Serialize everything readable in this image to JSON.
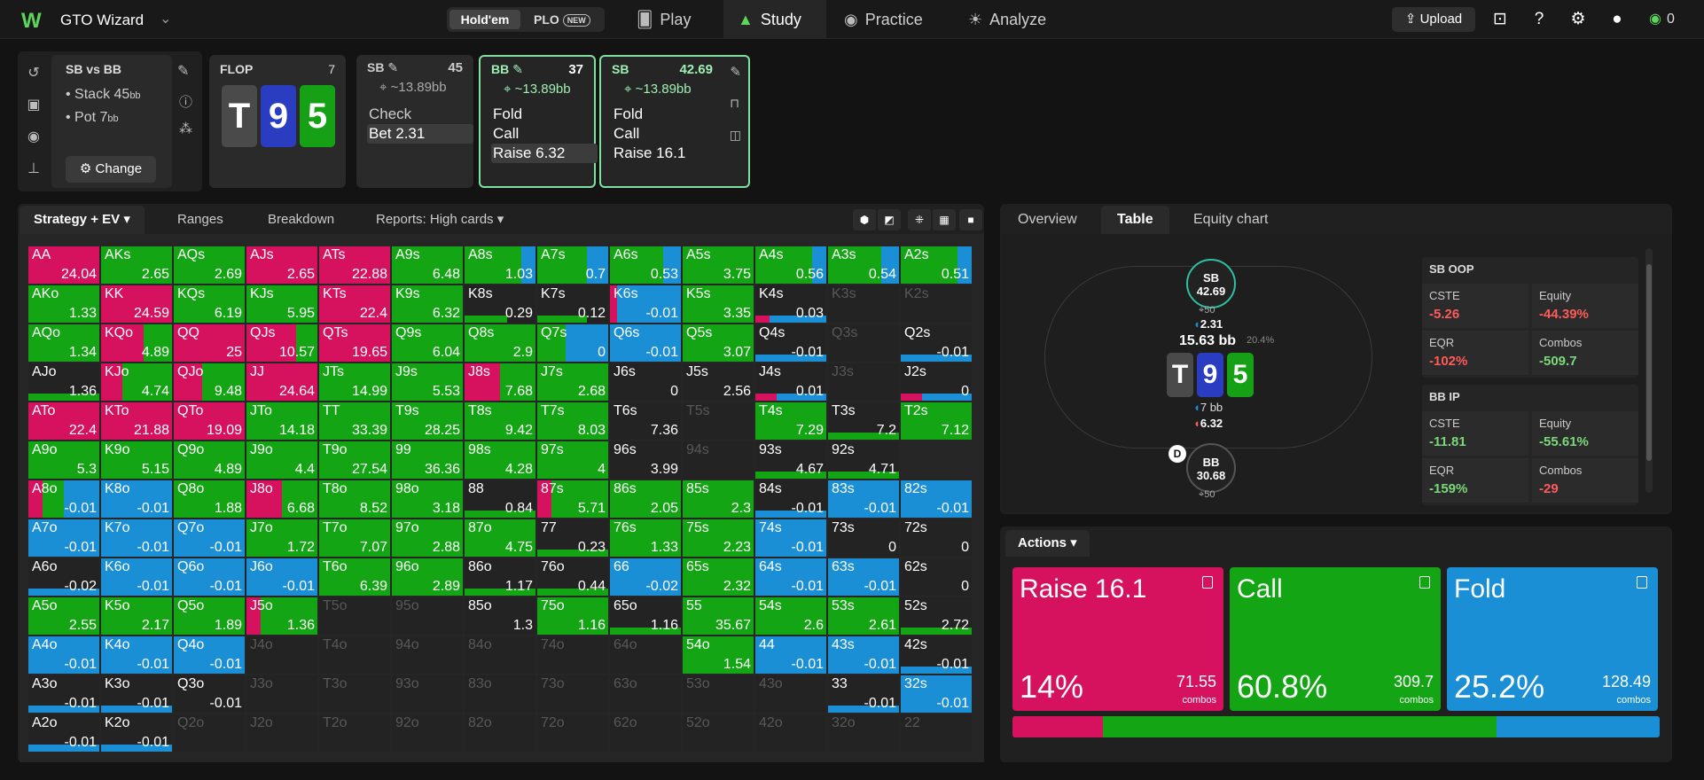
{
  "colors": {
    "raise": "#d6125e",
    "call": "#13a513",
    "fold": "#1a8fd6",
    "dark": "#232323",
    "accent": "#5ad65a"
  },
  "topbar": {
    "brand": "GTO Wizard",
    "modes": [
      "Hold'em",
      "PLO"
    ],
    "new_badge": "NEW",
    "nav": [
      "Play",
      "Study",
      "Practice",
      "Analyze"
    ],
    "upload": "Upload",
    "credits": "0",
    "icons": [
      "scan-icon",
      "help-icon",
      "settings-icon",
      "account-icon"
    ]
  },
  "spot": {
    "title": "SB vs BB",
    "stack_label": "Stack 45",
    "stack_unit": "bb",
    "pot_label": "Pot 7",
    "pot_unit": "bb",
    "change": "Change"
  },
  "flop": {
    "label": "FLOP",
    "pot": "7",
    "cards": [
      "T",
      "9",
      "5"
    ]
  },
  "decisions": [
    {
      "pos": "SB",
      "stack": "45",
      "eff": "~13.89bb",
      "actions": [
        "Check",
        "Bet 2.31"
      ],
      "hl": 1
    },
    {
      "pos": "BB",
      "stack": "37",
      "eff": "~13.89bb",
      "actions": [
        "Fold",
        "Call",
        "Raise 6.32"
      ],
      "hl": 2
    },
    {
      "pos": "SB",
      "stack": "42.69",
      "eff": "~13.89bb",
      "actions": [
        "Fold",
        "Call",
        "Raise 16.1"
      ],
      "hl": -1
    }
  ],
  "left_tabs": [
    "Strategy + EV",
    "Ranges",
    "Breakdown",
    "Reports: High cards"
  ],
  "right_tabs": [
    "Overview",
    "Table",
    "Equity chart"
  ],
  "grid": [
    [
      [
        "AA",
        "24.04",
        "r100"
      ],
      [
        "AKs",
        "2.65",
        "c100"
      ],
      [
        "AQs",
        "2.69",
        "c100"
      ],
      [
        "AJs",
        "2.65",
        "r100"
      ],
      [
        "ATs",
        "22.88",
        "r100"
      ],
      [
        "A9s",
        "6.48",
        "c100"
      ],
      [
        "A8s",
        "1.03",
        "c80f20"
      ],
      [
        "A7s",
        "0.7",
        "c70f30"
      ],
      [
        "A6s",
        "0.53",
        "c75f25"
      ],
      [
        "A5s",
        "3.75",
        "c100"
      ],
      [
        "A4s",
        "0.56",
        "c80f20"
      ],
      [
        "A3s",
        "0.54",
        "c75f25"
      ],
      [
        "A2s",
        "0.51",
        "c80f20"
      ]
    ],
    [
      [
        "AKo",
        "1.33",
        "c100"
      ],
      [
        "KK",
        "24.59",
        "r100"
      ],
      [
        "KQs",
        "6.19",
        "c100"
      ],
      [
        "KJs",
        "5.95",
        "c100"
      ],
      [
        "KTs",
        "22.4",
        "r100"
      ],
      [
        "K9s",
        "6.32",
        "c100"
      ],
      [
        "K8s",
        "0.29",
        "c60b"
      ],
      [
        "K7s",
        "0.12",
        "c70b"
      ],
      [
        "K6s",
        "-0.01",
        "r10f90"
      ],
      [
        "K5s",
        "3.35",
        "c100"
      ],
      [
        "K4s",
        "0.03",
        "r20f80b"
      ],
      [
        "K3s",
        "",
        "d"
      ],
      [
        "K2s",
        "",
        "d"
      ]
    ],
    [
      [
        "AQo",
        "1.34",
        "c100"
      ],
      [
        "KQo",
        "4.89",
        "r60c40"
      ],
      [
        "QQ",
        "25",
        "r100"
      ],
      [
        "QJs",
        "10.57",
        "r70c30"
      ],
      [
        "QTs",
        "19.65",
        "r100"
      ],
      [
        "Q9s",
        "6.04",
        "c100"
      ],
      [
        "Q8s",
        "2.9",
        "c100"
      ],
      [
        "Q7s",
        "0",
        "c40f60"
      ],
      [
        "Q6s",
        "-0.01",
        "f100"
      ],
      [
        "Q5s",
        "3.07",
        "c100"
      ],
      [
        "Q4s",
        "-0.01",
        "f100b"
      ],
      [
        "Q3s",
        "",
        "d"
      ],
      [
        "Q2s",
        "-0.01",
        "f100b"
      ]
    ],
    [
      [
        "AJo",
        "1.36",
        "c100b"
      ],
      [
        "KJo",
        "4.74",
        "r30c70"
      ],
      [
        "QJo",
        "9.48",
        "r40c60"
      ],
      [
        "JJ",
        "24.64",
        "r100"
      ],
      [
        "JTs",
        "14.99",
        "c100"
      ],
      [
        "J9s",
        "5.53",
        "c100"
      ],
      [
        "J8s",
        "7.68",
        "r50c50"
      ],
      [
        "J7s",
        "2.68",
        "c100"
      ],
      [
        "J6s",
        "0",
        "e"
      ],
      [
        "J5s",
        "2.56",
        "e"
      ],
      [
        "J4s",
        "0.01",
        "r30f70b"
      ],
      [
        "J3s",
        "",
        "d"
      ],
      [
        "J2s",
        "0",
        "r30f70b"
      ]
    ],
    [
      [
        "ATo",
        "22.4",
        "r100"
      ],
      [
        "KTo",
        "21.88",
        "r100"
      ],
      [
        "QTo",
        "19.09",
        "r100"
      ],
      [
        "JTo",
        "14.18",
        "c100"
      ],
      [
        "TT",
        "33.39",
        "c100"
      ],
      [
        "T9s",
        "28.25",
        "c100"
      ],
      [
        "T8s",
        "9.42",
        "c100"
      ],
      [
        "T7s",
        "8.03",
        "c100"
      ],
      [
        "T6s",
        "7.36",
        "e"
      ],
      [
        "T5s",
        "",
        "d"
      ],
      [
        "T4s",
        "7.29",
        "c100"
      ],
      [
        "T3s",
        "7.2",
        "c100b"
      ],
      [
        "T2s",
        "7.12",
        "c100"
      ]
    ],
    [
      [
        "A9o",
        "5.3",
        "c100"
      ],
      [
        "K9o",
        "5.15",
        "c100"
      ],
      [
        "Q9o",
        "4.89",
        "c100"
      ],
      [
        "J9o",
        "4.4",
        "c100"
      ],
      [
        "T9o",
        "27.54",
        "c100"
      ],
      [
        "99",
        "36.36",
        "c100"
      ],
      [
        "98s",
        "4.28",
        "c100"
      ],
      [
        "97s",
        "4",
        "c100"
      ],
      [
        "96s",
        "3.99",
        "e"
      ],
      [
        "94s",
        "",
        "d"
      ],
      [
        "93s",
        "4.67",
        "c100b"
      ],
      [
        "92s",
        "4.71",
        "c100b"
      ],
      [
        "",
        "",
        " "
      ]
    ],
    [
      [
        "A8o",
        "-0.01",
        "r20c30f50"
      ],
      [
        "K8o",
        "-0.01",
        "f100"
      ],
      [
        "Q8o",
        "1.88",
        "c100"
      ],
      [
        "J8o",
        "6.68",
        "r50c50"
      ],
      [
        "T8o",
        "8.52",
        "c100"
      ],
      [
        "98o",
        "3.18",
        "c100"
      ],
      [
        "88",
        "0.84",
        "c100b"
      ],
      [
        "87s",
        "5.71",
        "r20c80"
      ],
      [
        "86s",
        "2.05",
        "c100"
      ],
      [
        "85s",
        "2.3",
        "c100"
      ],
      [
        "84s",
        "-0.01",
        "f100b"
      ],
      [
        "83s",
        "-0.01",
        "f100"
      ],
      [
        "82s",
        "-0.01",
        "f100"
      ]
    ],
    [
      [
        "A7o",
        "-0.01",
        "f100"
      ],
      [
        "K7o",
        "-0.01",
        "f100"
      ],
      [
        "Q7o",
        "-0.01",
        "f100"
      ],
      [
        "J7o",
        "1.72",
        "c100"
      ],
      [
        "T7o",
        "7.07",
        "c100"
      ],
      [
        "97o",
        "2.88",
        "c100"
      ],
      [
        "87o",
        "4.75",
        "c100"
      ],
      [
        "77",
        "0.23",
        "c100b"
      ],
      [
        "76s",
        "1.33",
        "c100"
      ],
      [
        "75s",
        "2.23",
        "c100"
      ],
      [
        "74s",
        "-0.01",
        "f100"
      ],
      [
        "73s",
        "0",
        "e"
      ],
      [
        "72s",
        "0",
        "e"
      ]
    ],
    [
      [
        "A6o",
        "-0.02",
        "f100b"
      ],
      [
        "K6o",
        "-0.01",
        "f100"
      ],
      [
        "Q6o",
        "-0.01",
        "f100"
      ],
      [
        "J6o",
        "-0.01",
        "f100"
      ],
      [
        "T6o",
        "6.39",
        "c100"
      ],
      [
        "96o",
        "2.89",
        "c100"
      ],
      [
        "86o",
        "1.17",
        "c100b"
      ],
      [
        "76o",
        "0.44",
        "c100b"
      ],
      [
        "66",
        "-0.02",
        "f100"
      ],
      [
        "65s",
        "2.32",
        "c100"
      ],
      [
        "64s",
        "-0.01",
        "f100"
      ],
      [
        "63s",
        "-0.01",
        "f100"
      ],
      [
        "62s",
        "0",
        "e"
      ]
    ],
    [
      [
        "A5o",
        "2.55",
        "c100"
      ],
      [
        "K5o",
        "2.17",
        "c100"
      ],
      [
        "Q5o",
        "1.89",
        "c100"
      ],
      [
        "J5o",
        "1.36",
        "r20c80"
      ],
      [
        "T5o",
        "",
        "d"
      ],
      [
        "95o",
        "",
        "d"
      ],
      [
        "85o",
        "1.3",
        "e"
      ],
      [
        "75o",
        "1.16",
        "c100"
      ],
      [
        "65o",
        "1.16",
        "c100b"
      ],
      [
        "55",
        "35.67",
        "c100"
      ],
      [
        "54s",
        "2.6",
        "c100"
      ],
      [
        "53s",
        "2.61",
        "c100"
      ],
      [
        "52s",
        "2.72",
        "c100b"
      ]
    ],
    [
      [
        "A4o",
        "-0.01",
        "f100"
      ],
      [
        "K4o",
        "-0.01",
        "f100"
      ],
      [
        "Q4o",
        "-0.01",
        "f100"
      ],
      [
        "J4o",
        "",
        "d"
      ],
      [
        "T4o",
        "",
        "d"
      ],
      [
        "94o",
        "",
        "d"
      ],
      [
        "84o",
        "",
        "d"
      ],
      [
        "74o",
        "",
        "d"
      ],
      [
        "64o",
        "",
        "d"
      ],
      [
        "54o",
        "1.54",
        "c100"
      ],
      [
        "44",
        "-0.01",
        "f100"
      ],
      [
        "43s",
        "-0.01",
        "f100"
      ],
      [
        "42s",
        "-0.01",
        "f100b"
      ]
    ],
    [
      [
        "A3o",
        "-0.01",
        "f100b"
      ],
      [
        "K3o",
        "-0.01",
        "f100b"
      ],
      [
        "Q3o",
        "-0.01",
        "e"
      ],
      [
        "J3o",
        "",
        "d"
      ],
      [
        "T3o",
        "",
        "d"
      ],
      [
        "93o",
        "",
        "d"
      ],
      [
        "83o",
        "",
        "d"
      ],
      [
        "73o",
        "",
        "d"
      ],
      [
        "63o",
        "",
        "d"
      ],
      [
        "53o",
        "",
        "d"
      ],
      [
        "43o",
        "",
        "d"
      ],
      [
        "33",
        "-0.01",
        "f100b"
      ],
      [
        "32s",
        "-0.01",
        "f100"
      ]
    ],
    [
      [
        "A2o",
        "-0.01",
        "f100b"
      ],
      [
        "K2o",
        "-0.01",
        "f100b"
      ],
      [
        "Q2o",
        "",
        "d"
      ],
      [
        "J2o",
        "",
        "d"
      ],
      [
        "T2o",
        "",
        "d"
      ],
      [
        "92o",
        "",
        "d"
      ],
      [
        "82o",
        "",
        "d"
      ],
      [
        "72o",
        "",
        "d"
      ],
      [
        "62o",
        "",
        "d"
      ],
      [
        "52o",
        "",
        "d"
      ],
      [
        "42o",
        "",
        "d"
      ],
      [
        "32o",
        "",
        "d"
      ],
      [
        "22",
        "",
        "d"
      ]
    ]
  ],
  "table": {
    "sb": {
      "pos": "SB",
      "stack": "42.69",
      "chips": "50",
      "bet": "2.31"
    },
    "pot": "15.63 bb",
    "pot_pct": "20.4%",
    "bb": {
      "pos": "BB",
      "stack": "30.68",
      "chips": "50",
      "bet1": "7 bb",
      "bet2": "6.32"
    },
    "dealer": "D"
  },
  "stats": [
    {
      "title": "SB",
      "tag": "OOP",
      "rows": [
        [
          "CSTE",
          "-5.26",
          "red"
        ],
        [
          "Equity",
          "-44.39%",
          "red"
        ],
        [
          "EQR",
          "-102%",
          "red"
        ],
        [
          "Combos",
          "-509.7",
          "grn"
        ]
      ]
    },
    {
      "title": "BB",
      "tag": "IP",
      "rows": [
        [
          "CSTE",
          "-11.81",
          "grn"
        ],
        [
          "Equity",
          "-55.61%",
          "grn"
        ],
        [
          "EQR",
          "-159%",
          "grn"
        ],
        [
          "Combos",
          "-29",
          "red"
        ]
      ]
    }
  ],
  "actions_label": "Actions",
  "actions": [
    {
      "name": "Raise 16.1",
      "pct": "14%",
      "combos": "71.55",
      "frac": 0.14,
      "color": "#d6125e"
    },
    {
      "name": "Call",
      "pct": "60.8%",
      "combos": "309.7",
      "frac": 0.608,
      "color": "#13a513"
    },
    {
      "name": "Fold",
      "pct": "25.2%",
      "combos": "128.49",
      "frac": 0.252,
      "color": "#1a8fd6"
    }
  ],
  "combos_label": "combos"
}
